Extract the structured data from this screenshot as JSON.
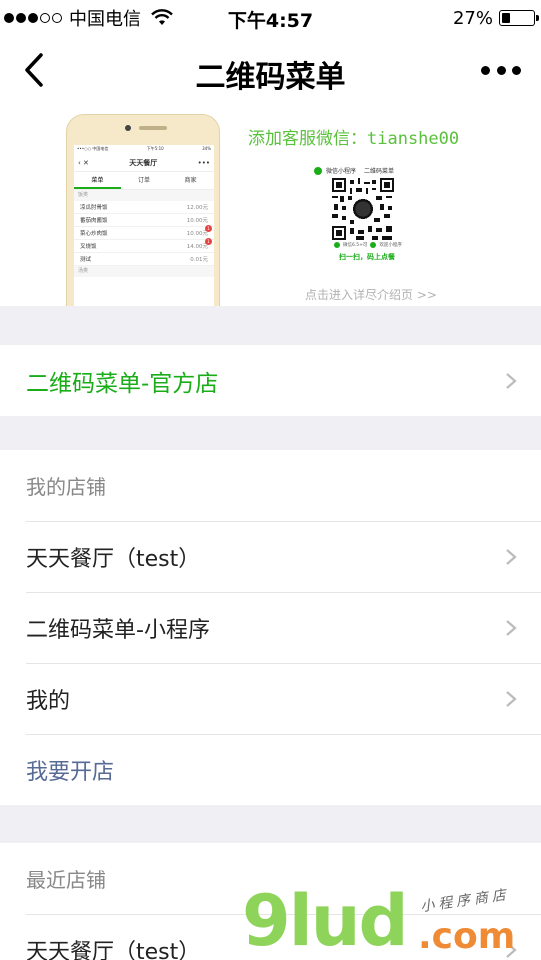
{
  "status_bar": {
    "carrier": "中国电信",
    "time": "下午4:57",
    "battery": "27%",
    "battery_level": 0.27
  },
  "nav": {
    "title": "二维码菜单",
    "back_icon": "chevron-left-icon",
    "more_icon": "more-dots-icon"
  },
  "banner": {
    "add_wechat": "添加客服微信：tianshe00",
    "phone": {
      "status_carrier": "•••○○ 中国电信",
      "status_time": "下午5:10",
      "status_battery": "34%",
      "title": "天天餐厅",
      "tabs": [
        "菜单",
        "订单",
        "商家"
      ],
      "category": "饭类",
      "items": [
        {
          "name": "凉瓜肘骨饭",
          "price": "12.00元",
          "badge": ""
        },
        {
          "name": "番茄肉酱饭",
          "price": "10.00元",
          "badge": ""
        },
        {
          "name": "菜心炒肉饭",
          "price": "10.00元",
          "badge": "1"
        },
        {
          "name": "叉烧饭",
          "price": "14.00元",
          "badge": "1"
        },
        {
          "name": "测试",
          "price": "0.01元",
          "badge": ""
        }
      ],
      "category2": "汤类"
    },
    "qr": {
      "head_left": "微信小程序",
      "head_right": "二维码菜单",
      "meta_left": "微信6.5+可",
      "meta_right": "欢迎小程序",
      "cta": "扫一扫，码上点餐"
    },
    "link": "点击进入详尽介绍页 >>"
  },
  "official": {
    "label": "二维码菜单-官方店"
  },
  "my_shops": {
    "header": "我的店铺",
    "items": [
      "天天餐厅（test）",
      "二维码菜单-小程序",
      "我的"
    ],
    "open_shop": "我要开店"
  },
  "recent": {
    "header": "最近店铺",
    "items": [
      "天天餐厅（test）"
    ]
  },
  "watermark": {
    "brand": "9lud",
    "domain": ".com",
    "tagline": "小程序商店"
  }
}
